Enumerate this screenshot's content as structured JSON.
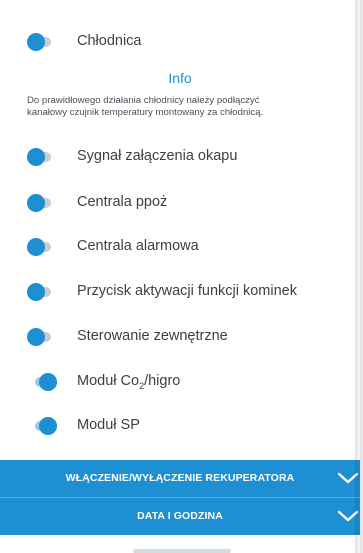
{
  "rows_top": [
    {
      "label": "Chłodnica",
      "on": false
    }
  ],
  "info": {
    "title": "Info",
    "text_line1": "Do prawidłowego działania chłodnicy należy podłączyć",
    "text_line2": "kanałowy czujnik temperatury montowany za chłodnicą."
  },
  "rows": [
    {
      "label": "Sygnał załączenia okapu",
      "on": false
    },
    {
      "label": "Centrala ppoż",
      "on": false
    },
    {
      "label": "Centrala alarmowa",
      "on": false
    },
    {
      "label": "Przycisk aktywacji funkcji kominek",
      "on": false
    },
    {
      "label": "Sterowanie zewnętrzne",
      "on": false
    },
    {
      "label_prefix": "Moduł Co",
      "label_sub": "2",
      "label_suffix": "/higro",
      "on": true
    },
    {
      "label": "Moduł SP",
      "on": true
    }
  ],
  "sections": [
    {
      "label": "WŁĄCZENIE/WYŁĄCZENIE REKUPERATORA",
      "icon": "chevron-down-icon"
    },
    {
      "label": "DATA I GODZINA",
      "icon": "chevron-down-icon"
    }
  ],
  "colors": {
    "accent": "#1e8fd2",
    "toggle_off_track": "#c9ccd0",
    "toggle_on_track": "#9cc9ea",
    "text": "#3b4148"
  }
}
